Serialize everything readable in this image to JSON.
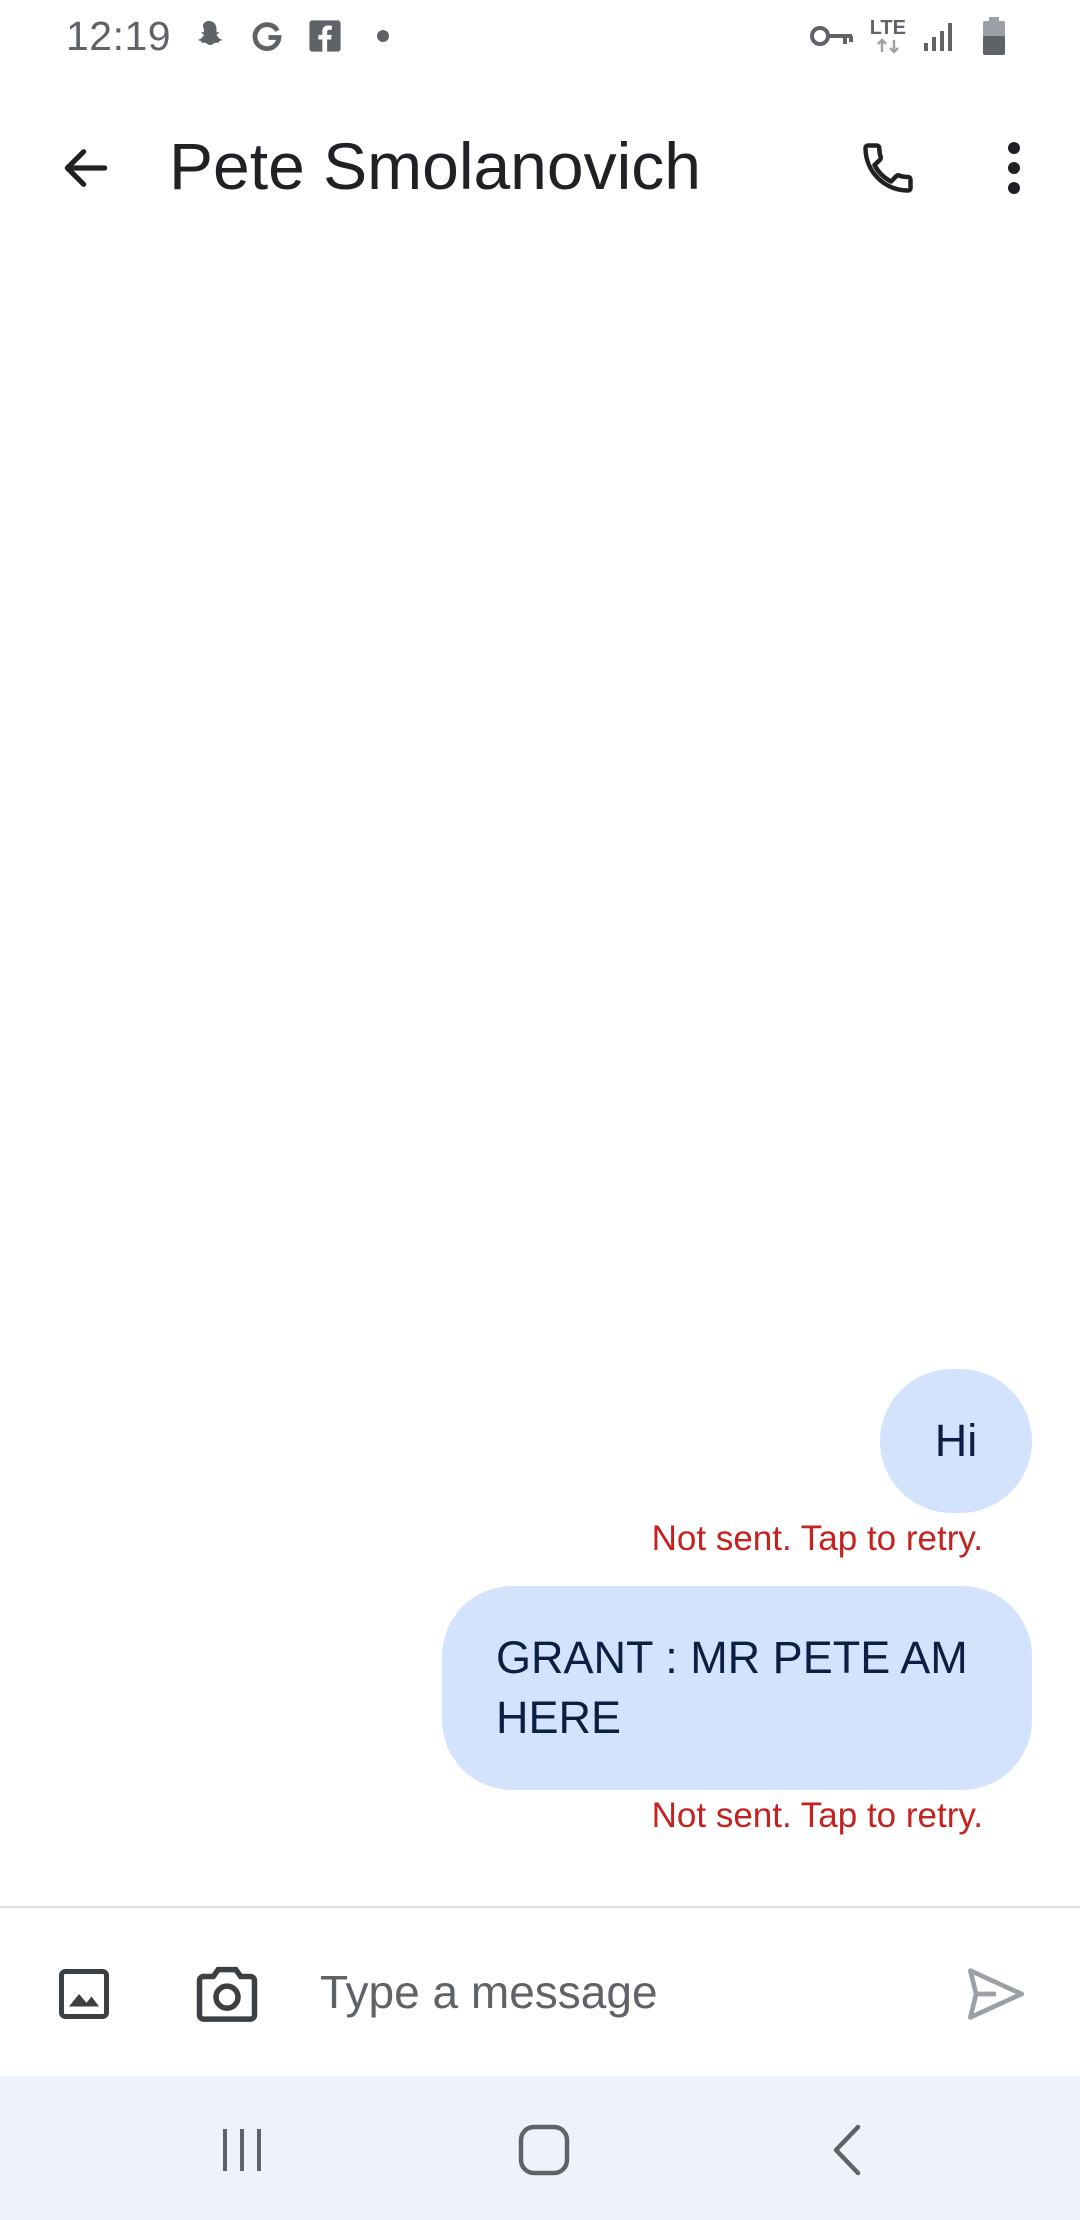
{
  "status_bar": {
    "time": "12:19",
    "left_icons": [
      "snapchat-icon",
      "google-icon",
      "facebook-icon",
      "dot-icon"
    ],
    "right_icons": [
      "vpn-key-icon",
      "lte-icon",
      "signal-icon",
      "battery-icon"
    ],
    "network_label": "LTE"
  },
  "app_bar": {
    "contact_name": "Pete Smolanovich",
    "back_icon": "arrow-left-icon",
    "call_icon": "phone-icon",
    "menu_icon": "more-vert-icon"
  },
  "messages": [
    {
      "text": "Hi",
      "direction": "outgoing",
      "status": "Not sent. Tap to retry."
    },
    {
      "text": "GRANT : MR PETE AM HERE",
      "direction": "outgoing",
      "status": "Not sent. Tap to retry."
    }
  ],
  "compose": {
    "placeholder": "Type a message",
    "value": "",
    "gallery_icon": "image-icon",
    "camera_icon": "camera-icon",
    "send_icon": "send-icon"
  },
  "nav_bar": {
    "buttons": [
      "recents-icon",
      "home-icon",
      "back-icon"
    ]
  },
  "colors": {
    "bubble": "#d3e3fd",
    "error": "#c5221f",
    "nav_bg": "#eff2fa"
  }
}
